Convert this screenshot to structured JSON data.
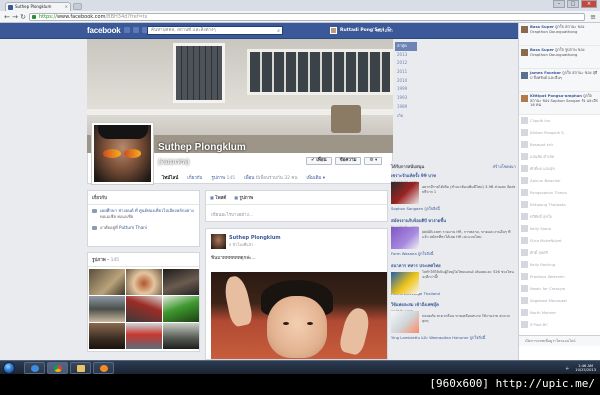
{
  "browser": {
    "tab_title": "Suthep Plongklum",
    "url_https": "https://",
    "url_host": "www.facebook.com",
    "url_rest": "/BBH34d?fref=ts"
  },
  "facebook": {
    "logo": "facebook",
    "search_placeholder": "ค้นหาบุคคล, สถานที่ และสิ่งต่างๆ",
    "user_name": "Ruttadi Pong'Se I",
    "home_label": "หน้าแรก"
  },
  "profile": {
    "name": "Suthep Plongklum",
    "nickname": "(จอมเทพ)",
    "buttons": {
      "friends": "✔ เพื่อน",
      "message": "ข้อความ"
    },
    "nav": {
      "timeline": "ไทม์ไลน์",
      "about": "เกี่ยวกับ",
      "photos": "รูปภาพ",
      "photos_count": "145",
      "friends": "เพื่อน",
      "friends_count": "มีเพื่อนร่วมกัน 32 คน",
      "more": "เพิ่มเติม ▾"
    }
  },
  "years": [
    "ล่าสุด",
    "2013",
    "2012",
    "2011",
    "2010",
    "1999",
    "1993",
    "1989",
    "เกิด"
  ],
  "about": {
    "title": "เกี่ยวกับ",
    "row1": "เคยศึกษา ช่างยนต์ ที่ ศูนย์ท่องเที่ยวไปเอียงหลักอย่าง",
    "row1_sub": "ทอเอเชีย ทอเอเชีย",
    "row2_prefix": "อาศัยอยู่ที่ ",
    "row2_place": "Puttum Thani"
  },
  "photos": {
    "title": "รูปภาพ",
    "count": "145"
  },
  "composer": {
    "tab_status": "โพสต์",
    "tab_photo": "รูปภาพ",
    "placeholder": "เขียนอะไรบางอย่าง..."
  },
  "post": {
    "author": "Suthep Plongklum",
    "time": "5 ชั่วโมงที่แล้ว ·",
    "text": "ฟีนมาททททททดุกล่ะ..."
  },
  "right": {
    "sponsored": "ได้รับการสนับสนุน",
    "create_ad": "สร้างโฆษณา",
    "ads": [
      {
        "title": "เซราะรักแท้ครั้ง 99 บาท",
        "url": "salestrial.com",
        "body": "อยากมีรายได้เพิ่ม (สำเนาต้องเพิ่มมีใหม่) 3-9B ส่วนลด จัดส่งฟรีจาก 1",
        "like": "Sophon Sangaen ถูกใจสิ่งนี้"
      },
      {
        "title": "สมัครงานกับจ็อบดีบี หาง่ายขึ้น",
        "url": "th.jobsdb.com",
        "body": "jobDB.com รวมงาน HR, การตลาด, ขายและงานอื่นๆ ที่แล้ว สมัครที่หาได้เลย HR เน่ะแบบไหม",
        "like": "Form Wasana ถูกใจสิ่งนี้"
      },
      {
        "title": "ธนาคาร ทหาร ประเทศไทย",
        "url": "",
        "body": "ไปทำให้ให้เป็นผู้ใหญ่ไม่ไทยแลนด์ เต็มลดและ 526 ช่วงไหนจะดีกว่านี้!",
        "like": "HMCG Directage Thailand"
      },
      {
        "title": "ใช้แพ่งสะสม เข้าถึงเฟซบุ๊ค",
        "url": "pollsth.com",
        "body": "ปลอดภัย สะดวกลื่อน ขายเคลือบสบาย ใช้งานง่าย สะดวก สุดๆ",
        "like": "Ying Lambrettu และ Weerapitan Hanuner ถูกใจสิ่งนี้"
      }
    ]
  },
  "ticker": [
    {
      "name": "Bass Super",
      "text": "ถูกใจ สถานะ ของ Orapthon Dounguathong"
    },
    {
      "name": "Bass Super",
      "text": "ถูกใจ รูปภาพ ของ Orapthon Dounguathong"
    },
    {
      "name": "James Facebor",
      "text": "ถูกใจ สถานะ ของ สุธีป จึงทรัพย์ และอื่นๆ"
    },
    {
      "name": "Kittipat Pongsa-amphan",
      "text": "ถูกใจ สถานะ ของ Sophon Sangon รัง และอีก 16 คน"
    }
  ],
  "chat": [
    "Clippiti Inu",
    "Kitikan Pongsuk S.",
    "Bosepot krit",
    "แสนชัย คำเชย",
    "ศักดิ์พล แสงสุข",
    "Apinun Bowchai",
    "Pongsaphon Tivevo",
    "Kittipong Thaiwata",
    "ทวีศักดิ์ สุขใจ",
    "Kelly Sama",
    "Eijca MoheNdyet",
    "ศักดิ์ สุขศรี",
    "Kelly Racking",
    "Pradleya Weerami",
    "Nwaic far Creasyw",
    "Sagdawe Manasaat",
    "North Maimer",
    "S'Plod BC"
  ],
  "chat_search": "เปิดการแชทเพื่อดูว่าใครออนไลน์",
  "taskbar": {
    "time": "1:46 AM",
    "date": "10/25/2013"
  },
  "watermark": "[960x600] http://upic.me/"
}
